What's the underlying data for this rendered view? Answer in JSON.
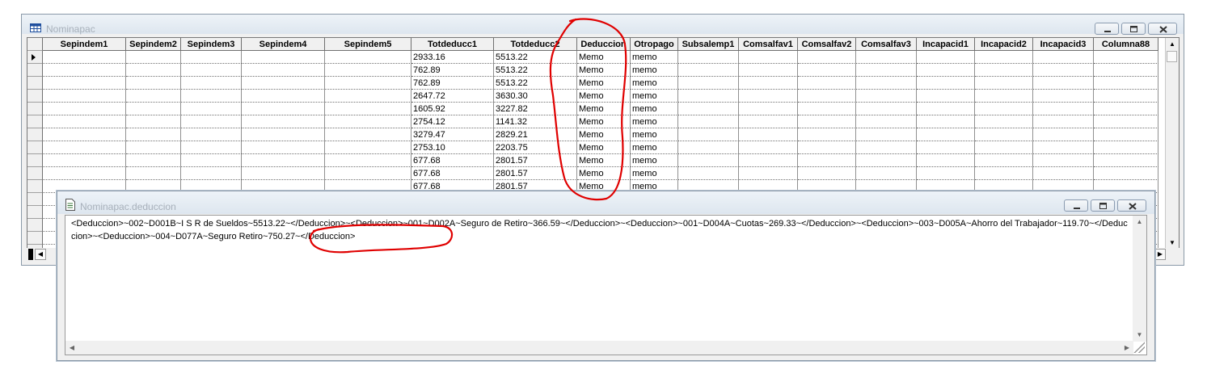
{
  "back_window": {
    "title": "Nominapac",
    "columns": [
      {
        "label": "Sepindem1",
        "w": 103
      },
      {
        "label": "Sepindem2",
        "w": 68
      },
      {
        "label": "Sepindem3",
        "w": 75
      },
      {
        "label": "Sepindem4",
        "w": 103
      },
      {
        "label": "Sepindem5",
        "w": 107
      },
      {
        "label": "Totdeducc1",
        "w": 102
      },
      {
        "label": "Totdeducc2",
        "w": 103
      },
      {
        "label": "Deduccion",
        "w": 66
      },
      {
        "label": "Otropago",
        "w": 59
      },
      {
        "label": "Subsalemp1",
        "w": 75
      },
      {
        "label": "Comsalfav1",
        "w": 73
      },
      {
        "label": "Comsalfav2",
        "w": 72
      },
      {
        "label": "Comsalfav3",
        "w": 75
      },
      {
        "label": "Incapacid1",
        "w": 72
      },
      {
        "label": "Incapacid2",
        "w": 72
      },
      {
        "label": "Incapacid3",
        "w": 75
      },
      {
        "label": "Columna88",
        "w": 80
      }
    ],
    "rows": [
      {
        "totdeducc1": "2933.16",
        "totdeducc2": "5513.22",
        "deduccion": "Memo",
        "otropago": "memo"
      },
      {
        "totdeducc1": "762.89",
        "totdeducc2": "5513.22",
        "deduccion": "Memo",
        "otropago": "memo"
      },
      {
        "totdeducc1": "762.89",
        "totdeducc2": "5513.22",
        "deduccion": "Memo",
        "otropago": "memo"
      },
      {
        "totdeducc1": "2647.72",
        "totdeducc2": "3630.30",
        "deduccion": "Memo",
        "otropago": "memo"
      },
      {
        "totdeducc1": "1605.92",
        "totdeducc2": "3227.82",
        "deduccion": "Memo",
        "otropago": "memo"
      },
      {
        "totdeducc1": "2754.12",
        "totdeducc2": "1141.32",
        "deduccion": "Memo",
        "otropago": "memo"
      },
      {
        "totdeducc1": "3279.47",
        "totdeducc2": "2829.21",
        "deduccion": "Memo",
        "otropago": "memo"
      },
      {
        "totdeducc1": "2753.10",
        "totdeducc2": "2203.75",
        "deduccion": "Memo",
        "otropago": "memo"
      },
      {
        "totdeducc1": "677.68",
        "totdeducc2": "2801.57",
        "deduccion": "Memo",
        "otropago": "memo"
      },
      {
        "totdeducc1": "677.68",
        "totdeducc2": "2801.57",
        "deduccion": "Memo",
        "otropago": "memo"
      },
      {
        "totdeducc1": "677.68",
        "totdeducc2": "2801.57",
        "deduccion": "Memo",
        "otropago": "memo"
      },
      {
        "totdeducc1": "",
        "totdeducc2": "",
        "deduccion": "",
        "otropago": ""
      },
      {
        "totdeducc1": "",
        "totdeducc2": "",
        "deduccion": "",
        "otropago": ""
      },
      {
        "totdeducc1": "",
        "totdeducc2": "",
        "deduccion": "",
        "otropago": ""
      },
      {
        "totdeducc1": "",
        "totdeducc2": "",
        "deduccion": "",
        "otropago": ""
      },
      {
        "totdeducc1": "",
        "totdeducc2": "",
        "deduccion": "",
        "otropago": ""
      }
    ]
  },
  "front_window": {
    "title": "Nominapac.deduccion",
    "memo_parts": [
      "<Deduccion>~002~D001B~I S R  de Sueldos~5513.22~</Deduccion>~<Deduccion>~001~D002A~Seguro de Retiro~366.59~</Deduccion>~<Deduccion>~001~D004A~Cuotas~269.33~</Deduccion>~<Deduccion>~003~D005A~Ahorro del Trabajador~119.70~</Deduccion>~<Deduccion>~004~",
      "D077A~Seguro Retiro~750.27~",
      "</Deduccion>"
    ]
  },
  "colors": {
    "annotation": "#e00000",
    "title_inactive": "#a7b0ba"
  },
  "icons": {
    "back_window": "table-grid-icon",
    "front_window": "memo-document-icon"
  }
}
